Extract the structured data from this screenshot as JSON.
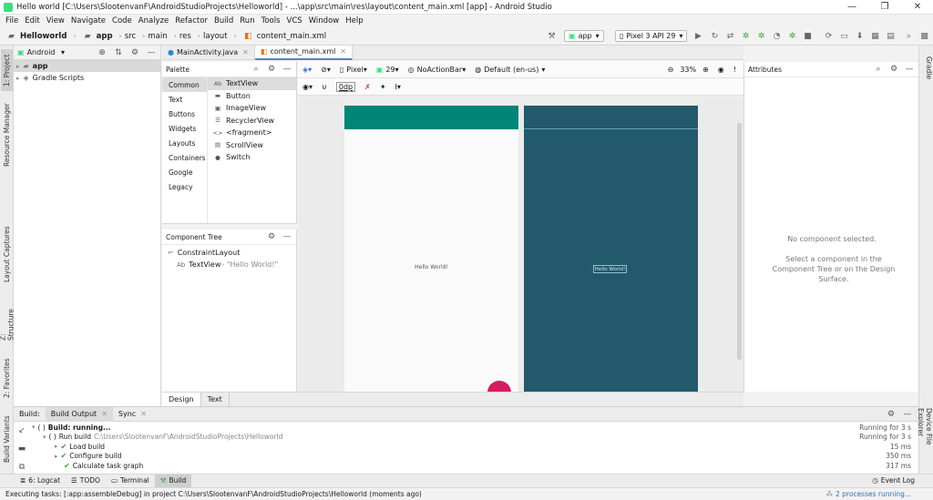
{
  "window": {
    "title": "Hello world [C:\\Users\\SlootenvanF\\AndroidStudioProjects\\Helloworld] - ...\\app\\src\\main\\res\\layout\\content_main.xml [app] - Android Studio",
    "controls": [
      "—",
      "❐",
      "✕"
    ]
  },
  "menu": [
    "File",
    "Edit",
    "View",
    "Navigate",
    "Code",
    "Analyze",
    "Refactor",
    "Build",
    "Run",
    "Tools",
    "VCS",
    "Window",
    "Help"
  ],
  "breadcrumb": [
    "Helloworld",
    "app",
    "src",
    "main",
    "res",
    "layout",
    "content_main.xml"
  ],
  "toolbar": {
    "run_config": "app",
    "device": "Pixel 3 API 29"
  },
  "left_tabs": [
    "1: Project",
    "Resource Manager",
    "Layout Captures",
    "Z: Structure",
    "2: Favorites",
    "Build Variants"
  ],
  "right_tabs": [
    "Gradle",
    "Device File Explorer"
  ],
  "project": {
    "view": "Android",
    "items": [
      {
        "label": "app",
        "bold": true
      },
      {
        "label": "Gradle Scripts",
        "bold": false
      }
    ]
  },
  "editor_tabs": [
    {
      "label": "MainActivity.java",
      "active": false
    },
    {
      "label": "content_main.xml",
      "active": true
    }
  ],
  "palette": {
    "title": "Palette",
    "categories": [
      "Common",
      "Text",
      "Buttons",
      "Widgets",
      "Layouts",
      "Containers",
      "Google",
      "Legacy"
    ],
    "widgets": [
      {
        "icon": "Ab",
        "label": "TextView"
      },
      {
        "icon": "▬",
        "label": "Button"
      },
      {
        "icon": "▣",
        "label": "ImageView"
      },
      {
        "icon": "☰",
        "label": "RecyclerView"
      },
      {
        "icon": "<>",
        "label": "<fragment>"
      },
      {
        "icon": "▤",
        "label": "ScrollView"
      },
      {
        "icon": "●",
        "label": "Switch"
      }
    ]
  },
  "component_tree": {
    "title": "Component Tree",
    "root": "ConstraintLayout",
    "child_icon": "Ab",
    "child": "TextView",
    "child_text": "- \"Hello World!\""
  },
  "design_toolbar": {
    "device": "Pixel",
    "api": "29",
    "theme": "NoActionBar",
    "locale": "Default (en-us)",
    "zoom": "33%",
    "margin": "0dp"
  },
  "surface": {
    "hello_text": "Hello World!",
    "colors": {
      "app_bar": "#008577",
      "blueprint": "#235a6b",
      "fab": "#d81b60"
    }
  },
  "view_tabs": [
    {
      "label": "Design",
      "active": true
    },
    {
      "label": "Text",
      "active": false
    }
  ],
  "attributes": {
    "title": "Attributes",
    "empty_title": "No component selected.",
    "empty_hint": "Select a component in the Component Tree or on the Design Surface."
  },
  "build": {
    "label": "Build:",
    "tabs": [
      {
        "label": "Build Output",
        "active": true
      },
      {
        "label": "Sync",
        "active": false
      }
    ],
    "lines": [
      {
        "indent": 0,
        "icon": "( )",
        "text": "Build: running...",
        "path": "",
        "time": "Running for 3 s",
        "bold": true
      },
      {
        "indent": 1,
        "icon": "( )",
        "text": "Run build",
        "path": "C:\\Users\\SlootenvanF\\AndroidStudioProjects\\Helloworld",
        "time": "Running for 3 s",
        "bold": false
      },
      {
        "indent": 2,
        "icon": "✔",
        "text": "Load build",
        "path": "",
        "time": "15 ms",
        "bold": false
      },
      {
        "indent": 2,
        "icon": "✔",
        "text": "Configure build",
        "path": "",
        "time": "350 ms",
        "bold": false
      },
      {
        "indent": 2,
        "icon": "✔",
        "text": "Calculate task graph",
        "path": "",
        "time": "317 ms",
        "bold": false
      }
    ]
  },
  "bottom_tabs": [
    {
      "label": "6: Logcat",
      "active": false
    },
    {
      "label": "TODO",
      "active": false
    },
    {
      "label": "Terminal",
      "active": false
    },
    {
      "label": "Build",
      "active": true
    }
  ],
  "event_log": "Event Log",
  "status": {
    "text": "Executing tasks: [:app:assembleDebug] in project C:\\Users\\SlootenvanF\\AndroidStudioProjects\\Helloworld (moments ago)",
    "processes": "2 processes running..."
  }
}
